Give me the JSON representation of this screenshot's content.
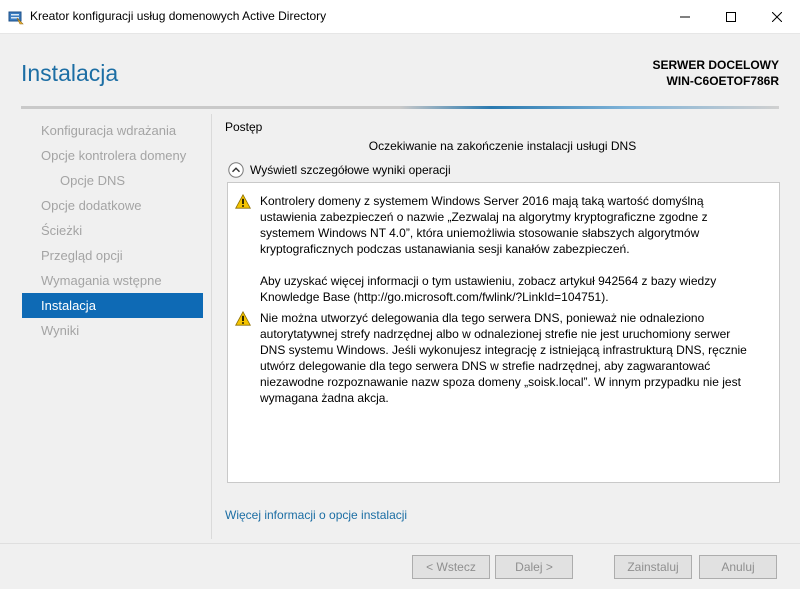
{
  "window": {
    "title": "Kreator konfiguracji usług domenowych Active Directory",
    "icon": "server-wizard-icon"
  },
  "header": {
    "page_title": "Instalacja",
    "server_label": "SERWER DOCELOWY",
    "server_name": "WIN-C6OETOF786R"
  },
  "nav": {
    "items": [
      {
        "label": "Konfiguracja wdrażania",
        "state": "disabled"
      },
      {
        "label": "Opcje kontrolera domeny",
        "state": "disabled"
      },
      {
        "label": "Opcje DNS",
        "state": "disabled"
      },
      {
        "label": "Opcje dodatkowe",
        "state": "disabled"
      },
      {
        "label": "Ścieżki",
        "state": "disabled"
      },
      {
        "label": "Przegląd opcji",
        "state": "disabled"
      },
      {
        "label": "Wymagania wstępne",
        "state": "disabled"
      },
      {
        "label": "Instalacja",
        "state": "active"
      },
      {
        "label": "Wyniki",
        "state": "disabled"
      }
    ]
  },
  "main": {
    "section_title": "Postęp",
    "status_text": "Oczekiwanie na zakończenie instalacji usługi DNS",
    "details_toggle_label": "Wyświetl szczegółowe wyniki operacji",
    "messages": [
      {
        "icon": "warning-icon",
        "paragraphs": [
          "Kontrolery domeny z systemem Windows Server 2016 mają taką wartość domyślną\nustawienia zabezpieczeń o nazwie „Zezwalaj na algorytmy kryptograficzne zgodne z\nsystemem Windows NT 4.0”, która uniemożliwia stosowanie słabszych algorytmów\nkryptograficznych podczas ustanawiania sesji kanałów zabezpieczeń.",
          "Aby uzyskać więcej informacji o tym ustawieniu, zobacz artykuł 942564 z bazy wiedzy\nKnowledge Base (http://go.microsoft.com/fwlink/?LinkId=104751)."
        ]
      },
      {
        "icon": "warning-icon",
        "paragraphs": [
          "Nie można utworzyć delegowania dla tego serwera DNS, ponieważ nie odnaleziono\nautorytatywnej strefy nadrzędnej albo w odnalezionej strefie nie jest uruchomiony serwer\nDNS systemu Windows. Jeśli wykonujesz integrację z istniejącą infrastrukturą DNS, ręcznie\nutwórz delegowanie dla tego serwera DNS w strefie nadrzędnej, aby zagwarantować\nniezawodne rozpoznawanie nazw spoza domeny „soisk.local”. W innym przypadku nie jest\nwymagana żadna akcja."
        ]
      }
    ],
    "more_info_link": "Więcej informacji o opcje instalacji"
  },
  "footer": {
    "back_label": "< Wstecz",
    "next_label": "Dalej >",
    "install_label": "Zainstaluj",
    "cancel_label": "Anuluj"
  },
  "colors": {
    "accent": "#1c6ea4",
    "nav_active_bg": "#0e6ab5",
    "nav_disabled_text": "#a4a4a4",
    "warning_fill": "#f5c400"
  }
}
